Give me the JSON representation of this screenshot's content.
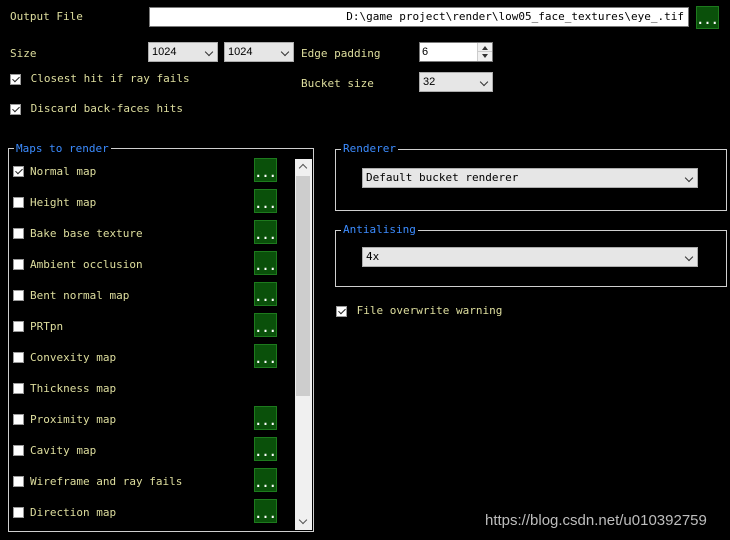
{
  "output_file": {
    "label": "Output File",
    "value": "D:\\game project\\render\\low05_face_textures\\eye_.tif",
    "browse_label": "..."
  },
  "size": {
    "label": "Size",
    "width": "1024",
    "height": "1024"
  },
  "edge_padding": {
    "label": "Edge padding",
    "value": "6"
  },
  "bucket_size": {
    "label": "Bucket size",
    "value": "32"
  },
  "options": {
    "closest_hit": {
      "label": "Closest hit if ray fails",
      "checked": true
    },
    "discard_back_faces": {
      "label": "Discard back-faces hits",
      "checked": true
    }
  },
  "maps_group": {
    "title": "Maps to render",
    "items": [
      {
        "label": "Normal map",
        "checked": true,
        "has_button": true
      },
      {
        "label": "Height map",
        "checked": false,
        "has_button": true
      },
      {
        "label": "Bake base texture",
        "checked": false,
        "has_button": true
      },
      {
        "label": "Ambient occlusion",
        "checked": false,
        "has_button": true
      },
      {
        "label": "Bent normal map",
        "checked": false,
        "has_button": true
      },
      {
        "label": "PRTpn",
        "checked": false,
        "has_button": true
      },
      {
        "label": "Convexity map",
        "checked": false,
        "has_button": true
      },
      {
        "label": "Thickness map",
        "checked": false,
        "has_button": false
      },
      {
        "label": "Proximity map",
        "checked": false,
        "has_button": true
      },
      {
        "label": "Cavity map",
        "checked": false,
        "has_button": true
      },
      {
        "label": "Wireframe and ray fails",
        "checked": false,
        "has_button": true
      },
      {
        "label": "Direction map",
        "checked": false,
        "has_button": true
      }
    ],
    "button_label": "..."
  },
  "renderer": {
    "title": "Renderer",
    "value": "Default bucket renderer"
  },
  "antialiasing": {
    "title": "Antialising",
    "value": "4x"
  },
  "file_overwrite_warning": {
    "label": "File overwrite warning",
    "checked": true
  },
  "watermark": "https://blog.csdn.net/u010392759"
}
